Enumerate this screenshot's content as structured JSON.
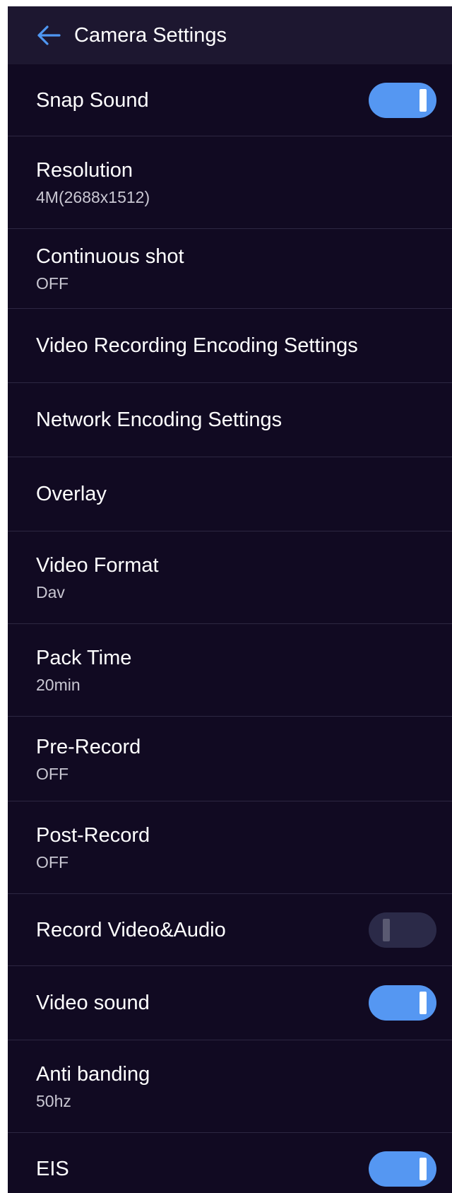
{
  "header": {
    "title": "Camera Settings",
    "back_icon": "arrow-left-icon",
    "back_icon_color": "#4f97f2"
  },
  "settings": {
    "snap_sound": {
      "label": "Snap Sound",
      "toggle": true
    },
    "resolution": {
      "label": "Resolution",
      "value": "4M(2688x1512)"
    },
    "continuous_shot": {
      "label": "Continuous shot",
      "value": "OFF"
    },
    "video_recording_encoding": {
      "label": "Video Recording Encoding Settings"
    },
    "network_encoding": {
      "label": "Network Encoding Settings"
    },
    "overlay": {
      "label": "Overlay"
    },
    "video_format": {
      "label": "Video Format",
      "value": "Dav"
    },
    "pack_time": {
      "label": "Pack Time",
      "value": "20min"
    },
    "pre_record": {
      "label": "Pre-Record",
      "value": "OFF"
    },
    "post_record": {
      "label": "Post-Record",
      "value": "OFF"
    },
    "record_video_audio": {
      "label": "Record Video&Audio",
      "toggle": false
    },
    "video_sound": {
      "label": "Video sound",
      "toggle": true
    },
    "anti_banding": {
      "label": "Anti banding",
      "value": "50hz"
    },
    "eis": {
      "label": "EIS",
      "toggle": true
    }
  },
  "colors": {
    "background": "#110a22",
    "header_background": "#1d1730",
    "toggle_on": "#5597f2",
    "toggle_off": "#2b2a48"
  }
}
